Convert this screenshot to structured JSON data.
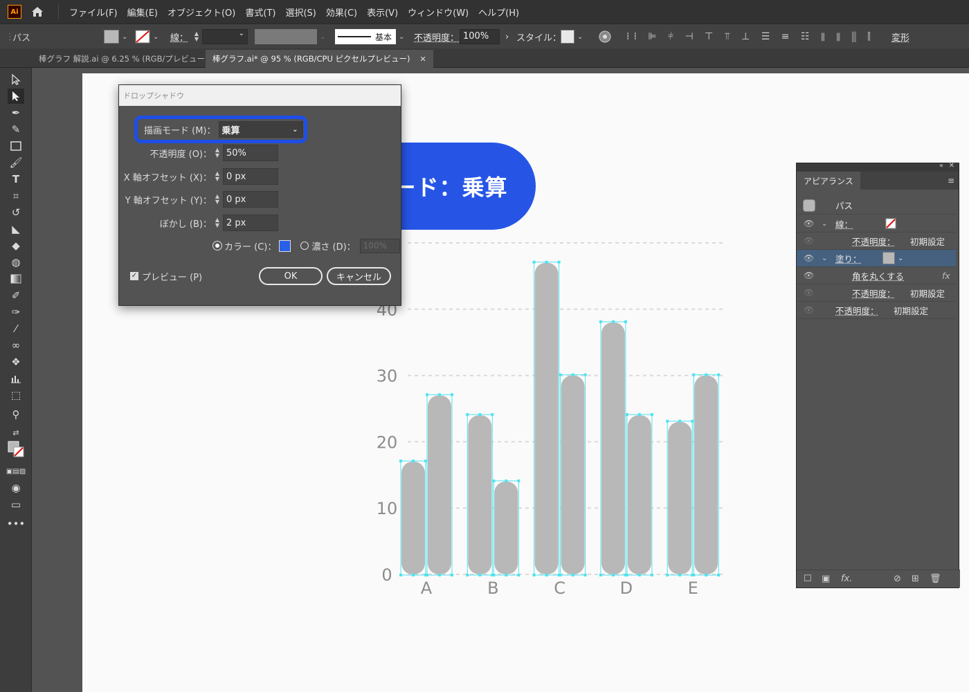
{
  "app": {
    "logo": "Ai",
    "menus": [
      "ファイル(F)",
      "編集(E)",
      "オブジェクト(O)",
      "書式(T)",
      "選択(S)",
      "効果(C)",
      "表示(V)",
      "ウィンドウ(W)",
      "ヘルプ(H)"
    ]
  },
  "control": {
    "object_type": "パス",
    "stroke_label": "線：",
    "stroke_profile": "基本",
    "opacity_label": "不透明度：",
    "opacity_value": "100%",
    "style_label": "スタイル：",
    "transform_label": "変形"
  },
  "tabs": [
    {
      "label": "棒グラフ 解説.ai @ 6.25 % (RGB/プレビュー)"
    },
    {
      "label": "棒グラフ.ai* @ 95 % (RGB/CPU ピクセルプレビュー)"
    }
  ],
  "dialog": {
    "title": "ドロップシャドウ",
    "mode_label": "描画モード (M)：",
    "mode_value": "乗算",
    "opacity_label": "不透明度 (O)：",
    "opacity_value": "50%",
    "x_label": "X 軸オフセット (X)：",
    "x_value": "0 px",
    "y_label": "Y 軸オフセット (Y)：",
    "y_value": "0 px",
    "blur_label": "ぼかし (B)：",
    "blur_value": "2 px",
    "color_label": "カラー (C)：",
    "color_hex": "#2a5fe8",
    "darkness_label": "濃さ (D)：",
    "darkness_value": "100%",
    "preview_label": "プレビュー (P)",
    "ok_label": "OK",
    "cancel_label": "キャンセル"
  },
  "callout": {
    "text": "描画モード：乗算"
  },
  "appearance": {
    "tab": "アピアランス",
    "object": "パス",
    "stroke_label": "線：",
    "stroke_opacity_label": "不透明度：",
    "stroke_opacity_value": "初期設定",
    "fill_label": "塗り：",
    "effect_label": "角を丸くする",
    "fill_opacity_label": "不透明度：",
    "fill_opacity_value": "初期設定",
    "opacity_label": "不透明度：",
    "opacity_value": "初期設定"
  },
  "chart_data": {
    "type": "bar",
    "categories": [
      "A",
      "B",
      "C",
      "D",
      "E"
    ],
    "series": [
      {
        "values": [
          17,
          24,
          47,
          38,
          23
        ]
      },
      {
        "values": [
          27,
          14,
          30,
          24,
          30
        ]
      }
    ],
    "y_ticks": [
      "0",
      "10",
      "20",
      "30",
      "40"
    ],
    "ylim": [
      0,
      50
    ],
    "grid": true,
    "bar_color": "#b8b8b8",
    "selection_color": "#4fe3f0"
  }
}
